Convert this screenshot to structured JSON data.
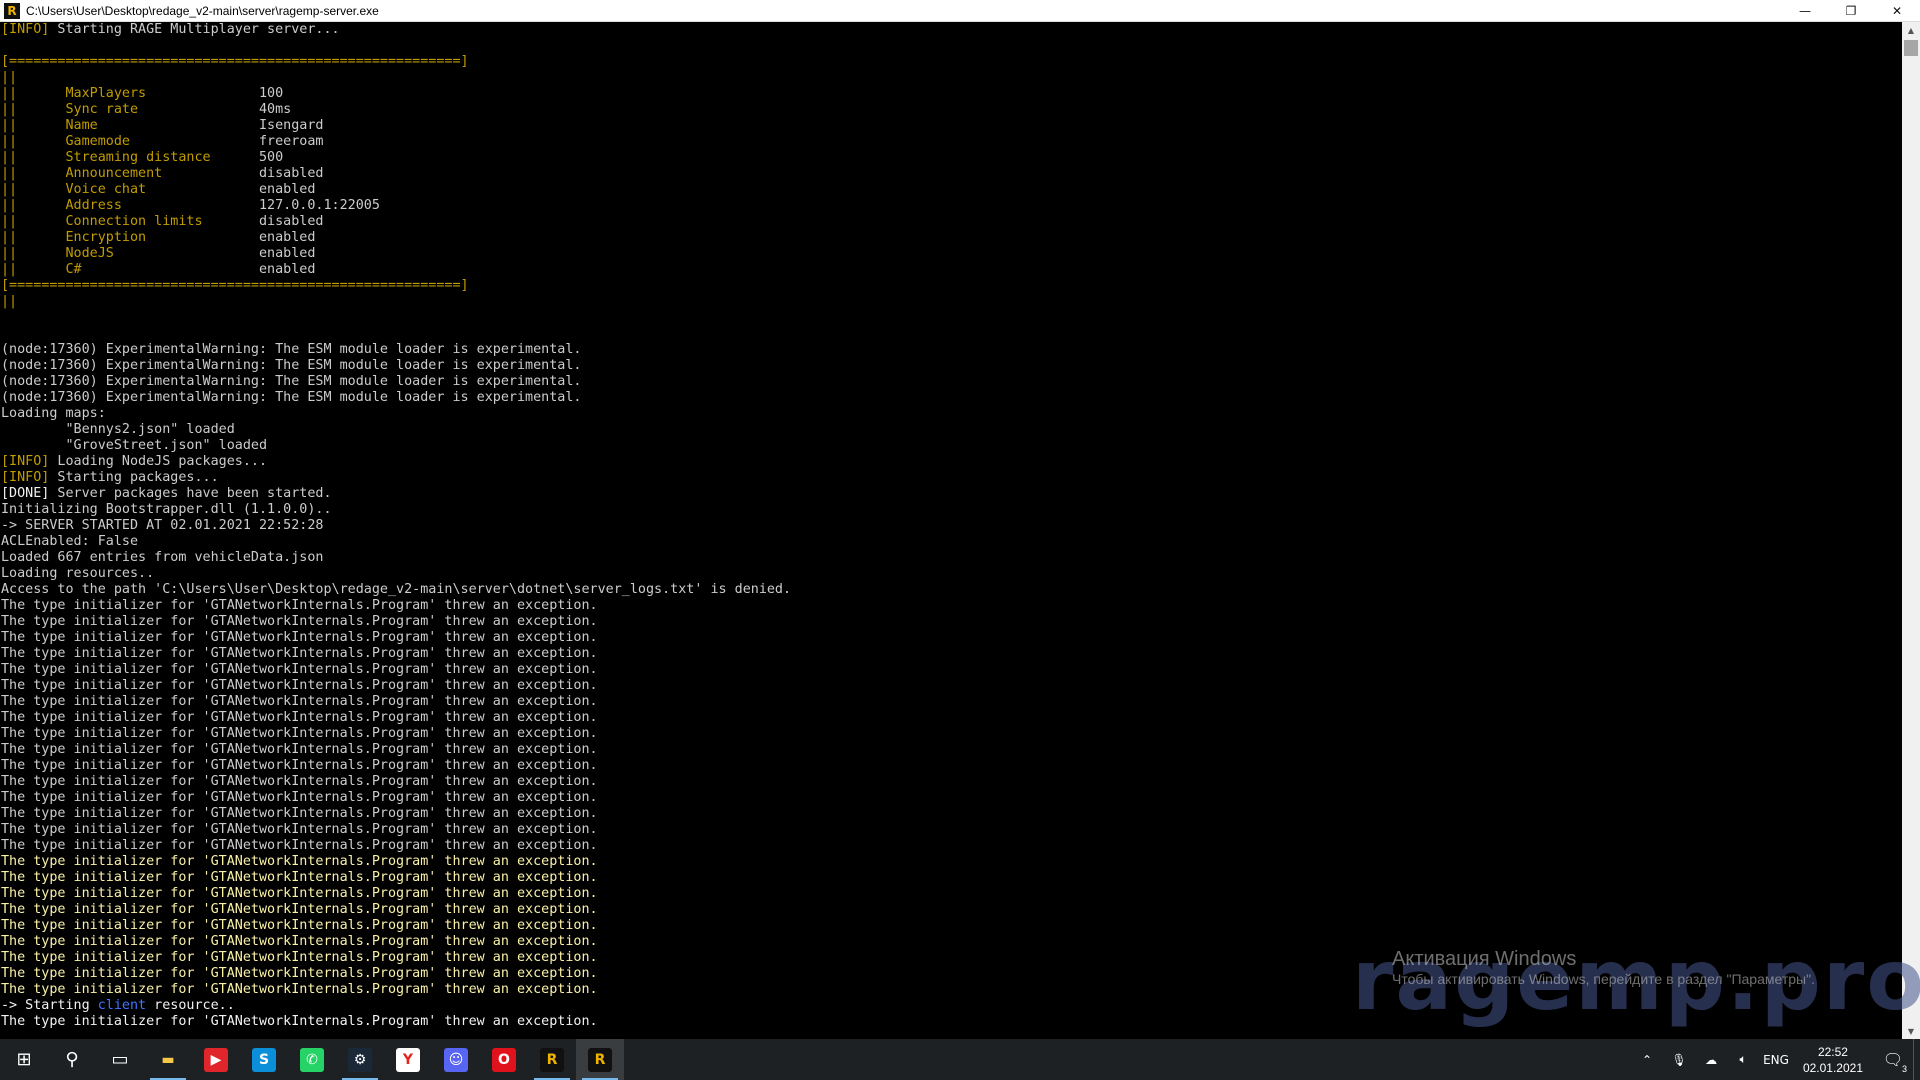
{
  "window": {
    "title": "C:\\Users\\User\\Desktop\\redage_v2-main\\server\\ragemp-server.exe",
    "icon_letter": "R",
    "minimize_icon": "minimize-icon",
    "maximize_icon": "restore-icon",
    "close_icon": "close-icon"
  },
  "console": {
    "lines": [
      [
        [
          "[INFO]",
          "gold"
        ],
        [
          " Starting RAGE Multiplayer server...",
          "default"
        ]
      ],
      [],
      [
        [
          "[========================================================]",
          "gold"
        ]
      ],
      [
        [
          "||",
          "gold"
        ]
      ],
      [
        [
          "||      ",
          "gold"
        ],
        [
          "MaxPlayers              ",
          "gold"
        ],
        [
          "100",
          "default"
        ]
      ],
      [
        [
          "||      ",
          "gold"
        ],
        [
          "Sync rate               ",
          "gold"
        ],
        [
          "40ms",
          "default"
        ]
      ],
      [
        [
          "||      ",
          "gold"
        ],
        [
          "Name                    ",
          "gold"
        ],
        [
          "Isengard",
          "default"
        ]
      ],
      [
        [
          "||      ",
          "gold"
        ],
        [
          "Gamemode                ",
          "gold"
        ],
        [
          "freeroam",
          "default"
        ]
      ],
      [
        [
          "||      ",
          "gold"
        ],
        [
          "Streaming distance      ",
          "gold"
        ],
        [
          "500",
          "default"
        ]
      ],
      [
        [
          "||      ",
          "gold"
        ],
        [
          "Announcement            ",
          "gold"
        ],
        [
          "disabled",
          "default"
        ]
      ],
      [
        [
          "||      ",
          "gold"
        ],
        [
          "Voice chat              ",
          "gold"
        ],
        [
          "enabled",
          "default"
        ]
      ],
      [
        [
          "||      ",
          "gold"
        ],
        [
          "Address                 ",
          "gold"
        ],
        [
          "127.0.0.1:22005",
          "default"
        ]
      ],
      [
        [
          "||      ",
          "gold"
        ],
        [
          "Connection limits       ",
          "gold"
        ],
        [
          "disabled",
          "default"
        ]
      ],
      [
        [
          "||      ",
          "gold"
        ],
        [
          "Encryption              ",
          "gold"
        ],
        [
          "enabled",
          "default"
        ]
      ],
      [
        [
          "||      ",
          "gold"
        ],
        [
          "NodeJS                  ",
          "gold"
        ],
        [
          "enabled",
          "default"
        ]
      ],
      [
        [
          "||      ",
          "gold"
        ],
        [
          "C#                      ",
          "gold"
        ],
        [
          "enabled",
          "default"
        ]
      ],
      [
        [
          "[========================================================]",
          "gold"
        ]
      ],
      [
        [
          "||",
          "gold"
        ]
      ],
      [],
      [],
      [
        [
          "(node:17360) ExperimentalWarning: The ESM module loader is experimental.",
          "default"
        ]
      ],
      [
        [
          "(node:17360) ExperimentalWarning: The ESM module loader is experimental.",
          "default"
        ]
      ],
      [
        [
          "(node:17360) ExperimentalWarning: The ESM module loader is experimental.",
          "default"
        ]
      ],
      [
        [
          "(node:17360) ExperimentalWarning: The ESM module loader is experimental.",
          "default"
        ]
      ],
      [
        [
          "Loading maps:",
          "default"
        ]
      ],
      [
        [
          "        \"Bennys2.json\" loaded",
          "default"
        ]
      ],
      [
        [
          "        \"GroveStreet.json\" loaded",
          "default"
        ]
      ],
      [
        [
          "[INFO]",
          "gold"
        ],
        [
          " Loading NodeJS packages...",
          "default"
        ]
      ],
      [
        [
          "[INFO]",
          "gold"
        ],
        [
          " Starting packages...",
          "default"
        ]
      ],
      [
        [
          "[DONE]",
          "white"
        ],
        [
          " Server packages have been started.",
          "default"
        ]
      ],
      [
        [
          "Initializing Bootstrapper.dll (1.1.0.0)..",
          "default"
        ]
      ],
      [
        [
          "-> SERVER STARTED AT 02.01.2021 22:52:28",
          "default"
        ]
      ],
      [
        [
          "ACLEnabled: False",
          "default"
        ]
      ],
      [
        [
          "Loaded 667 entries from vehicleData.json",
          "default"
        ]
      ],
      [
        [
          "Loading resources..",
          "default"
        ]
      ],
      [
        [
          "Access to the path 'C:\\Users\\User\\Desktop\\redage_v2-main\\server\\dotnet\\server_logs.txt' is denied.",
          "default"
        ]
      ],
      [
        [
          "The type initializer for 'GTANetworkInternals.Program' threw an exception.",
          "default"
        ]
      ],
      [
        [
          "The type initializer for 'GTANetworkInternals.Program' threw an exception.",
          "default"
        ]
      ],
      [
        [
          "The type initializer for 'GTANetworkInternals.Program' threw an exception.",
          "default"
        ]
      ],
      [
        [
          "The type initializer for 'GTANetworkInternals.Program' threw an exception.",
          "default"
        ]
      ],
      [
        [
          "The type initializer for 'GTANetworkInternals.Program' threw an exception.",
          "default"
        ]
      ],
      [
        [
          "The type initializer for 'GTANetworkInternals.Program' threw an exception.",
          "default"
        ]
      ],
      [
        [
          "The type initializer for 'GTANetworkInternals.Program' threw an exception.",
          "default"
        ]
      ],
      [
        [
          "The type initializer for 'GTANetworkInternals.Program' threw an exception.",
          "default"
        ]
      ],
      [
        [
          "The type initializer for 'GTANetworkInternals.Program' threw an exception.",
          "default"
        ]
      ],
      [
        [
          "The type initializer for 'GTANetworkInternals.Program' threw an exception.",
          "default"
        ]
      ],
      [
        [
          "The type initializer for 'GTANetworkInternals.Program' threw an exception.",
          "default"
        ]
      ],
      [
        [
          "The type initializer for 'GTANetworkInternals.Program' threw an exception.",
          "default"
        ]
      ],
      [
        [
          "The type initializer for 'GTANetworkInternals.Program' threw an exception.",
          "default"
        ]
      ],
      [
        [
          "The type initializer for 'GTANetworkInternals.Program' threw an exception.",
          "default"
        ]
      ],
      [
        [
          "The type initializer for 'GTANetworkInternals.Program' threw an exception.",
          "default"
        ]
      ],
      [
        [
          "The type initializer for 'GTANetworkInternals.Program' threw an exception.",
          "default"
        ]
      ],
      [
        [
          "The type initializer for 'GTANetworkInternals.Program' threw an exception.",
          "yellow"
        ]
      ],
      [
        [
          "The type initializer for 'GTANetworkInternals.Program' threw an exception.",
          "yellow"
        ]
      ],
      [
        [
          "The type initializer for 'GTANetworkInternals.Program' threw an exception.",
          "yellow"
        ]
      ],
      [
        [
          "The type initializer for 'GTANetworkInternals.Program' threw an exception.",
          "yellow"
        ]
      ],
      [
        [
          "The type initializer for 'GTANetworkInternals.Program' threw an exception.",
          "yellow"
        ]
      ],
      [
        [
          "The type initializer for 'GTANetworkInternals.Program' threw an exception.",
          "yellow"
        ]
      ],
      [
        [
          "The type initializer for 'GTANetworkInternals.Program' threw an exception.",
          "yellow"
        ]
      ],
      [
        [
          "The type initializer for 'GTANetworkInternals.Program' threw an exception.",
          "yellow"
        ]
      ],
      [
        [
          "The type initializer for 'GTANetworkInternals.Program' threw an exception.",
          "yellow"
        ]
      ],
      [
        [
          "-> Starting ",
          "white"
        ],
        [
          "client",
          "blue"
        ],
        [
          " resource..",
          "white"
        ]
      ],
      [
        [
          "The type initializer for 'GTANetworkInternals.Program' threw an exception.",
          "white"
        ]
      ]
    ]
  },
  "watermarks": {
    "activation_title": "Активация Windows",
    "activation_subtitle": "Чтобы активировать Windows, перейдите в раздел \"Параметры\".",
    "brand": "ragemp.pro"
  },
  "taskbar": {
    "apps": [
      {
        "name": "start-button",
        "icon": "windows-logo-icon",
        "glyph": "⊞",
        "color": "#ffffff",
        "bg": "transparent",
        "state": "none"
      },
      {
        "name": "search-button",
        "icon": "search-icon",
        "glyph": "⚲",
        "color": "#ffffff",
        "bg": "transparent",
        "state": "none"
      },
      {
        "name": "task-view-button",
        "icon": "task-view-icon",
        "glyph": "▭",
        "color": "#ffffff",
        "bg": "transparent",
        "state": "none"
      },
      {
        "name": "taskbar-file-explorer",
        "icon": "folder-icon",
        "glyph": "▬",
        "color": "#f7c948",
        "bg": "transparent",
        "state": "running"
      },
      {
        "name": "taskbar-youtube",
        "icon": "play-icon",
        "glyph": "▶",
        "color": "#ffffff",
        "bg": "#e0262b",
        "state": "none"
      },
      {
        "name": "taskbar-skype",
        "icon": "skype-icon",
        "glyph": "S",
        "color": "#ffffff",
        "bg": "#0c8fd9",
        "state": "none"
      },
      {
        "name": "taskbar-whatsapp",
        "icon": "whatsapp-icon",
        "glyph": "✆",
        "color": "#ffffff",
        "bg": "#25d366",
        "state": "none"
      },
      {
        "name": "taskbar-steam",
        "icon": "steam-icon",
        "glyph": "⚙",
        "color": "#ffffff",
        "bg": "#1b2838",
        "state": "running"
      },
      {
        "name": "taskbar-yandex",
        "icon": "yandex-browser-icon",
        "glyph": "Y",
        "color": "#e52620",
        "bg": "#ffffff",
        "state": "none"
      },
      {
        "name": "taskbar-discord",
        "icon": "discord-icon",
        "glyph": "☺",
        "color": "#ffffff",
        "bg": "#5865f2",
        "state": "none"
      },
      {
        "name": "taskbar-opera",
        "icon": "opera-icon",
        "glyph": "O",
        "color": "#ffffff",
        "bg": "#e0121b",
        "state": "none"
      },
      {
        "name": "taskbar-ragemp",
        "icon": "ragemp-icon",
        "glyph": "R",
        "color": "#f0b400",
        "bg": "#111111",
        "state": "running"
      },
      {
        "name": "taskbar-ragemp-server",
        "icon": "ragemp-icon",
        "glyph": "R",
        "color": "#f0b400",
        "bg": "#111111",
        "state": "active"
      }
    ],
    "tray": {
      "chevron_icon": "chevron-up-icon",
      "mic_icon": "microphone-icon",
      "cloud_icon": "cloud-icon",
      "volume_icon": "volume-icon",
      "language": "ENG",
      "time": "22:52",
      "date": "02.01.2021",
      "notification_icon": "notification-icon",
      "notification_count": "3"
    }
  },
  "colors": {
    "default": "#cccccc",
    "gold": "#c19c00",
    "white": "#f2f2f2",
    "yellow": "#f9f1a5",
    "blue": "#3b78ff"
  }
}
